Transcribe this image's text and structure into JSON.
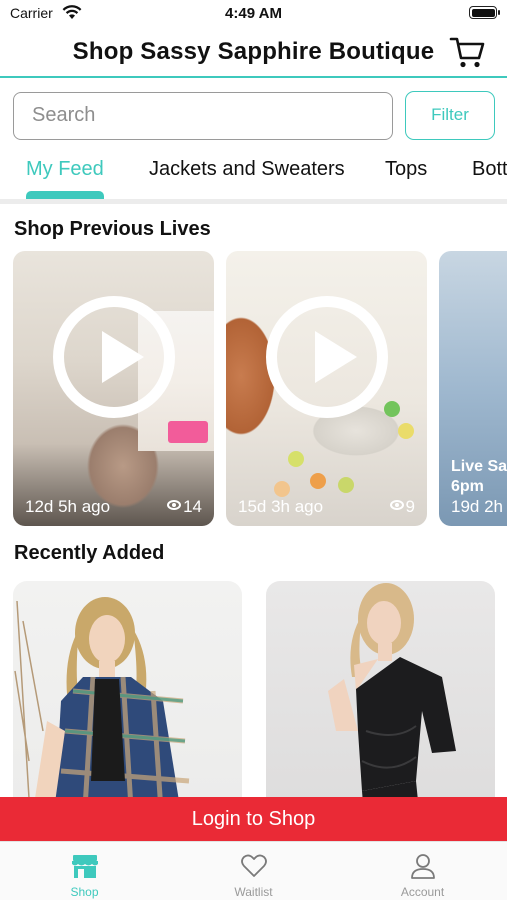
{
  "status_bar": {
    "carrier": "Carrier",
    "time": "4:49 AM"
  },
  "header": {
    "title": "Shop Sassy Sapphire Boutique",
    "cart_icon": "cart-icon"
  },
  "search": {
    "placeholder": "Search",
    "filter_label": "Filter"
  },
  "tabs": [
    {
      "label": "My Feed",
      "active": true
    },
    {
      "label": "Jackets and Sweaters",
      "active": false
    },
    {
      "label": "Tops",
      "active": false
    },
    {
      "label": "Bott",
      "active": false
    }
  ],
  "previous_lives": {
    "title": "Shop Previous Lives",
    "cards": [
      {
        "time": "12d 5h ago",
        "views": "14"
      },
      {
        "time": "15d 3h ago",
        "views": "9"
      },
      {
        "label": "Live Sa\n6pm",
        "time": "19d 2h"
      }
    ]
  },
  "recently_added": {
    "title": "Recently Added"
  },
  "login_banner": {
    "label": "Login to Shop"
  },
  "bottom_nav": {
    "items": [
      {
        "label": "Shop",
        "icon": "storefront-icon",
        "active": true
      },
      {
        "label": "Waitlist",
        "icon": "heart-icon",
        "active": false
      },
      {
        "label": "Account",
        "icon": "person-icon",
        "active": false
      }
    ]
  },
  "colors": {
    "accent": "#3ec9bd",
    "login_banner": "#ea2a36"
  }
}
